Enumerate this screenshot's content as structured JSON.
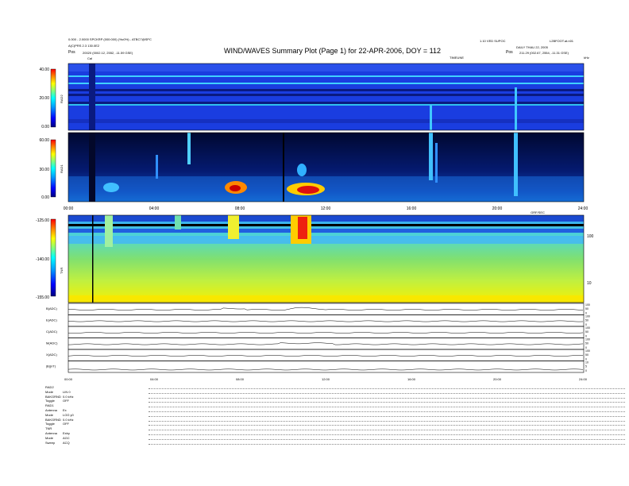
{
  "header": {
    "title": "WIND/WAVES Summary Plot (Page 1) for 22-APR-2006, DOY = 112",
    "left_line1": "0.000 - 2.0000 SPCKRP (000:000) (%c0%) - ATBC7@SPC",
    "left_line2": "A(C)PRS 2.3 130.0E2",
    "left_pos_label": "Pos",
    "left_pos_value": "20020 (0002.12, 2552, -11.59 GSE)",
    "right_line1": "1.10 VED SUPOC",
    "right_line2": "L2BFOOT.at.n01",
    "right_line3": "DAILY THAU 22, 2005",
    "right_pos_label": "Pos",
    "right_pos_value": "211.29 (002.67, 2554, -11.31 GSE)",
    "cal_label": "Cal",
    "top_axis_label": "TIMEUNE",
    "top_axis_unit": "kHz"
  },
  "chart_data": [
    {
      "type": "heatmap",
      "panel": "RAD2",
      "ylabel": "RAD2",
      "yticks": [
        "0.00",
        "20.00",
        "40.00"
      ],
      "ylim": [
        0,
        40
      ],
      "background": "#1a3de0"
    },
    {
      "type": "heatmap",
      "panel": "RAD1",
      "ylabel": "RAD1",
      "yticks": [
        "0.00",
        "30.00",
        "60.00"
      ],
      "ylim": [
        0,
        60
      ],
      "x_ticks": [
        "00:00",
        "04:00",
        "08:00",
        "12:00",
        "16:00",
        "20:00",
        "24:00"
      ],
      "x_axis_label": "GRF/SEC",
      "background": "#08155a"
    },
    {
      "type": "heatmap",
      "panel": "TNR",
      "ylabel": "TNR",
      "yticks": [
        "-155.00",
        "-140.00",
        "-125.00"
      ],
      "ylim": [
        -155,
        -125
      ],
      "right_ticks": [
        "10",
        "100"
      ],
      "background": "#7ee060"
    },
    {
      "type": "line",
      "panels": [
        {
          "label": "B(ADC)",
          "right_ticks": [
            "100",
            "50",
            "0"
          ]
        },
        {
          "label": "E(ADC)",
          "right_ticks": [
            "100",
            "50",
            "0"
          ]
        },
        {
          "label": "C(ADC)",
          "right_ticks": [
            "100",
            "50",
            "0"
          ]
        },
        {
          "label": "M(ADC)",
          "right_ticks": [
            "100",
            "50",
            "0"
          ]
        },
        {
          "label": "X(ADC)",
          "right_ticks": [
            "100",
            "50",
            "0"
          ]
        },
        {
          "label": "|B|(nT)",
          "right_ticks": [
            "10",
            "5",
            "0"
          ]
        }
      ],
      "x_ticks": [
        "00:00",
        "04:00",
        "08:00",
        "12:00",
        "16:00",
        "20:00",
        "24:00"
      ]
    }
  ],
  "footer": [
    {
      "label": "RAD2",
      "value": ""
    },
    {
      "label": "Mode",
      "value": "LIN 0"
    },
    {
      "label": "BAKGRND",
      "value": "0.0 kHz"
    },
    {
      "label": "Toggle",
      "value": "OFF"
    },
    {
      "label": "RAD1",
      "value": ""
    },
    {
      "label": "Antenna",
      "value": "Ex"
    },
    {
      "label": "Mode",
      "value": "LOG y0"
    },
    {
      "label": "BAKGRND",
      "value": "0.0 kHz"
    },
    {
      "label": "Toggle",
      "value": "OFF"
    },
    {
      "label": "TNR",
      "value": ""
    },
    {
      "label": "Antenna",
      "value": "Exby"
    },
    {
      "label": "Mode",
      "value": "AGC"
    },
    {
      "label": "Sweep",
      "value": "ACQ"
    }
  ],
  "colors": {
    "colorbar": [
      "#000080",
      "#0000ff",
      "#0080ff",
      "#00ffff",
      "#80ff80",
      "#ffff00",
      "#ff8000",
      "#ff0000",
      "#800000"
    ]
  }
}
